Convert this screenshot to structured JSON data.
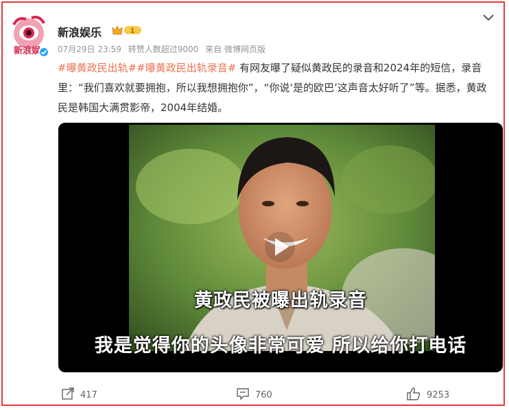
{
  "post": {
    "author": "新浪娱乐",
    "badge_level": "1",
    "date": "07月29日 23:59",
    "likes_note": "转赞人数超过9000",
    "source": "来自 微博网页版",
    "hashtag1": "#曝黄政民出轨#",
    "hashtag2": "#曝黄政民出轨录音#",
    "text_part1": " 有网友曝了疑似黄政民的录音和2024年的短信，录音里：“我们喜欢就要拥抱，所以我想拥抱你”，“你说‘是的欧巴’这声音太好听了”等。据悉，黄政民是韩国大满贯影帝，2004年结婚。"
  },
  "video": {
    "caption_title": "黄政民被曝出轨录音",
    "caption_subtitle": "我是觉得你的头像非常可爱 所以给你打电话"
  },
  "actions": {
    "repost_count": "417",
    "comment_count": "760",
    "like_count": "9253"
  },
  "colors": {
    "frame": "#e23b3b",
    "hashtag": "#eb7350",
    "verified": "#2aa4f4"
  },
  "icons": [
    "avatar-logo",
    "verified-icon",
    "level-badge-icon",
    "chevron-down-icon",
    "play-icon",
    "repost-icon",
    "comment-icon",
    "like-icon"
  ]
}
